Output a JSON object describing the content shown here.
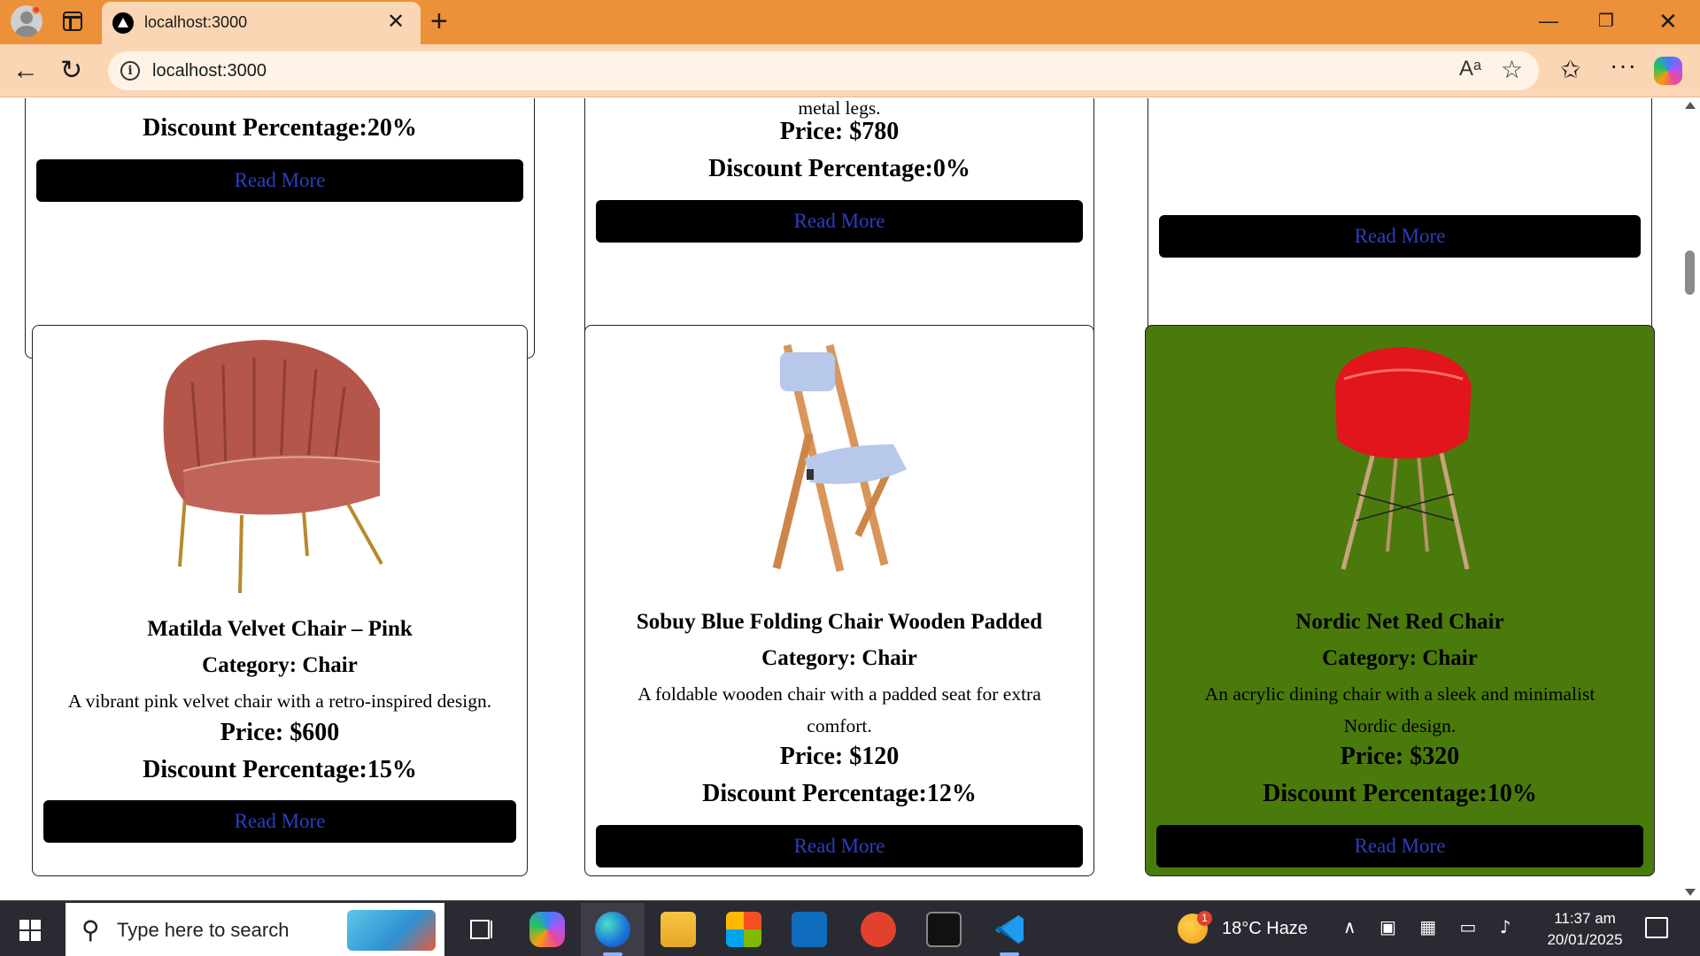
{
  "browser": {
    "tab_title": "localhost:3000",
    "url": "localhost:3000",
    "read_aloud_label": "Aᵃ",
    "close_tab_glyph": "✕",
    "new_tab_glyph": "+",
    "minimize_glyph": "—",
    "maximize_glyph": "❐",
    "close_window_glyph": "✕"
  },
  "top_row": [
    {
      "name": "partial-card-1",
      "discount": "Discount Percentage:20%",
      "button": "Read More"
    },
    {
      "name": "partial-card-2",
      "desc_tail": "metal legs.",
      "price": "Price: $780",
      "discount": "Discount Percentage:0%",
      "button": "Read More"
    },
    {
      "name": "partial-card-3",
      "button": "Read More"
    }
  ],
  "products": [
    {
      "image": "pink-velvet-chair",
      "title": "Matilda Velvet Chair – Pink",
      "category": "Category: Chair",
      "description": "A vibrant pink velvet chair with a retro-inspired design.",
      "price": "Price: $600",
      "discount": "Discount Percentage:15%",
      "button": "Read More"
    },
    {
      "image": "blue-folding-chair",
      "title": "Sobuy Blue Folding Chair Wooden Padded",
      "category": "Category: Chair",
      "description_line1": "A foldable wooden chair with a padded seat for extra",
      "description_line2": "comfort.",
      "price": "Price: $120",
      "discount": "Discount Percentage:12%",
      "button": "Read More"
    },
    {
      "image": "red-acrylic-chair",
      "title": "Nordic Net Red Chair",
      "category": "Category: Chair",
      "description_line1": "An acrylic dining chair with a sleek and minimalist",
      "description_line2": "Nordic design.",
      "price": "Price: $320",
      "discount": "Discount Percentage:10%",
      "button": "Read More",
      "highlight_color": "#4b7a0c"
    }
  ],
  "taskbar": {
    "search_placeholder": "Type here to search",
    "weather_badge": "1",
    "weather": "18°C  Haze",
    "tray_icons": "∧ ▣ ▦ ▭ ♪",
    "time": "11:37 am",
    "date": "20/01/2025"
  },
  "colors": {
    "chrome": "#ec9039",
    "tab_active": "#fad6b4",
    "button_text": "#2c3ec0",
    "taskbar": "#2a2a33"
  }
}
